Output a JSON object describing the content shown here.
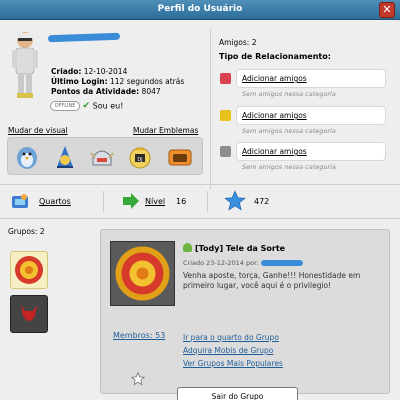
{
  "window": {
    "title": "Perfil do Usuário",
    "close_label": "✕"
  },
  "profile": {
    "criado_label": "Criado:",
    "criado_value": "12-10-2014",
    "login_label": "Último Login:",
    "login_value": "112 segundos atrás",
    "pontos_label": "Pontos da Atividade:",
    "pontos_value": "8047",
    "motto_badge": "OFFLINE",
    "friend_status": "Sou eu!",
    "mudar_visual": "Mudar de visual",
    "mudar_emblemas": "Mudar Emblemas",
    "badges": [
      "penguin-badge",
      "blue-hat-badge",
      "viking-helmet-badge",
      "royal-crest-badge",
      "camera-badge"
    ]
  },
  "friends": {
    "amigos": "Amigos: 2",
    "tipo_title": "Tipo de Relacionamento:",
    "relations": [
      {
        "icon": "heart-icon",
        "color": "#d9434f",
        "action": "Adicionar amigos",
        "sub": "Sem amigos nessa categoria"
      },
      {
        "icon": "smile-icon",
        "color": "#e8c21c",
        "action": "Adicionar amigos",
        "sub": "Sem amigos nessa categoria"
      },
      {
        "icon": "skull-icon",
        "color": "#8d8d8d",
        "action": "Adicionar amigos",
        "sub": "Sem amigos nessa categoria"
      }
    ]
  },
  "stats": {
    "quartos": "Quartos",
    "nivel_label": "Nível",
    "nivel_value": "16",
    "star_value": "472"
  },
  "groups": {
    "label": "Grupos: 2",
    "selected": {
      "name": "[Tody] Tele da Sorte",
      "created": "Criado 23-12-2014 por:",
      "description": "Venha aposte, torça, Ganhe!!! Honestidade em primeiro lugar, você aqui é o privilegio!",
      "membros": "Membros: 53",
      "links": [
        "Ir para o quarto do Grupo",
        "Adquira Mobis de Grupo",
        "Ver Grupos Mais Populares"
      ],
      "leave": "Sair do Grupo"
    }
  },
  "colors": {
    "title_bar": "#2c6e9a",
    "link_blue": "#1f5d99",
    "redaction": "#3a8cd8"
  }
}
